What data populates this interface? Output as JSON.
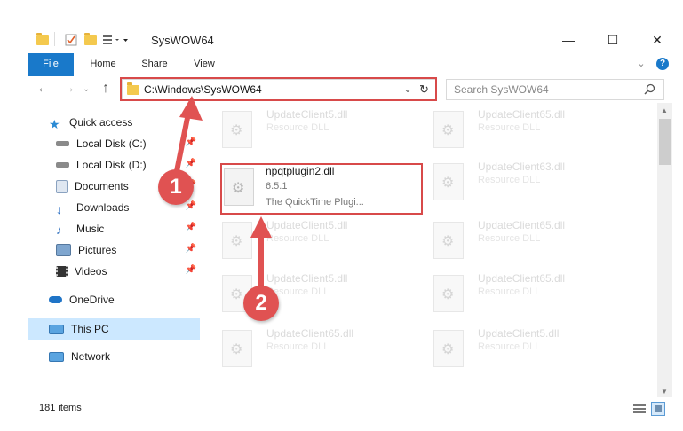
{
  "window": {
    "title": "SysWOW64",
    "minimize": "—",
    "maximize": "☐",
    "close": "✕"
  },
  "ribbon": {
    "tabs": [
      {
        "label": "File"
      },
      {
        "label": "Home"
      },
      {
        "label": "Share"
      },
      {
        "label": "View"
      }
    ],
    "expand_icon": "⌄",
    "help_icon": "?"
  },
  "address": {
    "path": "C:\\Windows\\SysWOW64",
    "search_placeholder": "Search SysWOW64"
  },
  "sidebar": {
    "items": [
      {
        "label": "Quick access"
      },
      {
        "label": "Local Disk (C:)"
      },
      {
        "label": "Local Disk (D:)"
      },
      {
        "label": "Documents"
      },
      {
        "label": "Downloads"
      },
      {
        "label": "Music"
      },
      {
        "label": "Pictures"
      },
      {
        "label": "Videos"
      },
      {
        "label": "OneDrive"
      },
      {
        "label": "This PC"
      },
      {
        "label": "Network"
      }
    ]
  },
  "files": {
    "highlighted": {
      "name": "npqtplugin2.dll",
      "version": "6.5.1",
      "description": "The QuickTime Plugi..."
    },
    "others": [
      {
        "name": "UpdateClient5.dll",
        "type": "Resource DLL"
      },
      {
        "name": "UpdateClient65.dll",
        "type": "Resource DLL"
      },
      {
        "name": "UpdateClient63.dll",
        "type": "Resource DLL"
      },
      {
        "name": "UpdateClient5.dll",
        "type": "Resource DLL"
      },
      {
        "name": "UpdateClient65.dll",
        "type": "Resource DLL"
      },
      {
        "name": "UpdateClient5.dll",
        "type": "Resource DLL"
      },
      {
        "name": "UpdateClient65.dll",
        "type": "Resource DLL"
      },
      {
        "name": "UpdateClient65.dll",
        "type": "Resource DLL"
      },
      {
        "name": "UpdateClient5.dll",
        "type": "Resource DLL"
      }
    ]
  },
  "annotations": {
    "step1": "1",
    "step2": "2",
    "color": "#e05252"
  },
  "status": {
    "item_count": "181 items"
  }
}
